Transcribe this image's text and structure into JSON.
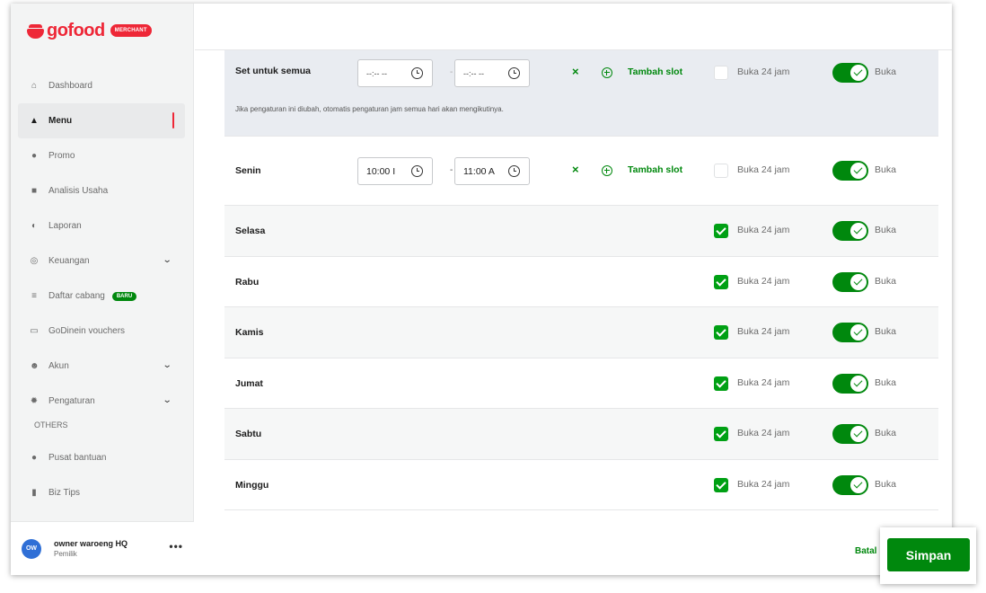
{
  "brand": {
    "name": "gofood",
    "badge": "MERCHANT"
  },
  "sidebar": {
    "items": [
      {
        "label": "Dashboard",
        "icon": "home-icon"
      },
      {
        "label": "Menu",
        "icon": "cloche-icon"
      },
      {
        "label": "Promo",
        "icon": "promo-icon"
      },
      {
        "label": "Analisis Usaha",
        "icon": "analytics-icon"
      },
      {
        "label": "Laporan",
        "icon": "report-icon"
      },
      {
        "label": "Keuangan",
        "icon": "wallet-icon"
      },
      {
        "label": "Daftar cabang",
        "icon": "store-icon",
        "badge": "BARU"
      },
      {
        "label": "GoDinein vouchers",
        "icon": "voucher-icon"
      },
      {
        "label": "Akun",
        "icon": "users-icon"
      },
      {
        "label": "Pengaturan",
        "icon": "gear-icon"
      }
    ],
    "others_label": "OTHERS",
    "others": [
      {
        "label": "Pusat bantuan",
        "icon": "help-icon"
      },
      {
        "label": "Biz Tips",
        "icon": "bookmark-icon"
      }
    ]
  },
  "user": {
    "initials": "OW",
    "name": "owner waroeng HQ",
    "role": "Pemilik",
    "more": "•••"
  },
  "schedule": {
    "set_all": {
      "label": "Set untuk semua",
      "open_placeholder": "--:-- --",
      "close_placeholder": "--:-- --",
      "separator": "-",
      "note": "Jika pengaturan ini diubah, otomatis pengaturan jam semua hari akan mengikutinya.",
      "remove": "×",
      "add_slot": "Tambah slot",
      "open24": "Buka 24 jam",
      "open24_checked": false,
      "status": "Buka",
      "status_on": true
    },
    "senin": {
      "label": "Senin",
      "open_time": "10:00 I",
      "close_time": "11:00 A",
      "separator": "-",
      "remove": "×",
      "add_slot": "Tambah slot",
      "open24": "Buka 24 jam",
      "open24_checked": false,
      "status": "Buka",
      "status_on": true
    },
    "days": [
      {
        "label": "Selasa",
        "open24": "Buka 24 jam",
        "open24_checked": true,
        "status": "Buka",
        "status_on": true
      },
      {
        "label": "Rabu",
        "open24": "Buka 24 jam",
        "open24_checked": true,
        "status": "Buka",
        "status_on": true
      },
      {
        "label": "Kamis",
        "open24": "Buka 24 jam",
        "open24_checked": true,
        "status": "Buka",
        "status_on": true
      },
      {
        "label": "Jumat",
        "open24": "Buka 24 jam",
        "open24_checked": true,
        "status": "Buka",
        "status_on": true
      },
      {
        "label": "Sabtu",
        "open24": "Buka 24 jam",
        "open24_checked": true,
        "status": "Buka",
        "status_on": true
      },
      {
        "label": "Minggu",
        "open24": "Buka 24 jam",
        "open24_checked": true,
        "status": "Buka",
        "status_on": true
      }
    ]
  },
  "footer": {
    "cancel": "Batal",
    "save": "Simpan"
  },
  "colors": {
    "brand_red": "#ee2737",
    "primary_green": "#00880d",
    "check_green": "#00a014",
    "set_all_bg": "#e9ecf1"
  }
}
